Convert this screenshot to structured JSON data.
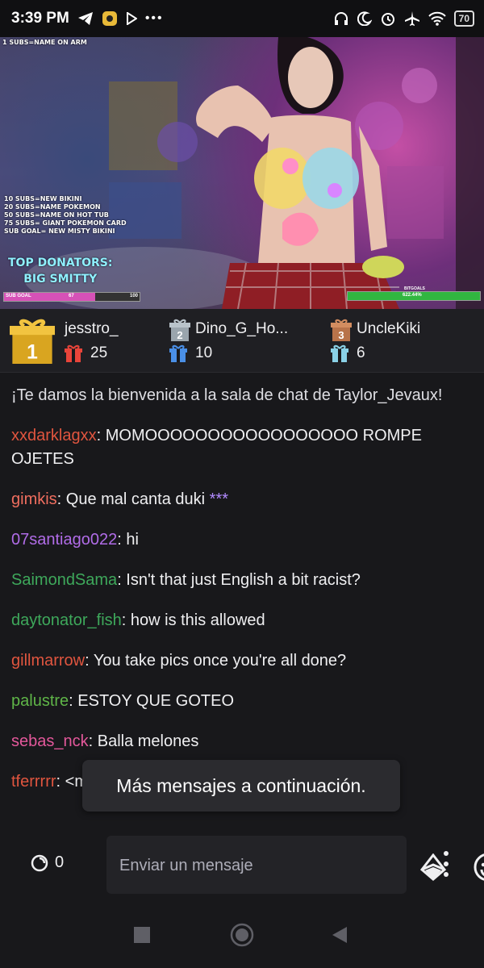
{
  "status_bar": {
    "time": "3:39 PM",
    "battery": "70",
    "left_icons": [
      "telegram-icon",
      "app-badge-icon",
      "play-store-icon",
      "more-dots-icon"
    ],
    "right_icons": [
      "headphones-icon",
      "moon-icon",
      "alarm-icon",
      "airplane-icon",
      "wifi-icon"
    ]
  },
  "stream": {
    "top_overlay": "1 SUBS=NAME ON ARM",
    "sub_goals": "10 SUBS=NEW BIKINI\n20 SUBS=NAME POKEMON\n50 SUBS=NAME ON HOT TUB\n75 SUBS= GIANT POKEMON CARD\nSUB GOAL= NEW MISTY BIKINI",
    "donators_title": "TOP DONATORS:",
    "donators_name": "BIG SMITTY",
    "sub_goal_label": "SUB GOAL",
    "sub_goal_current": "67",
    "sub_goal_target": "100",
    "sub_goal_progress": 0.67,
    "bit_goal_label": "BITGOALS",
    "bit_goal_percent": "622.44%"
  },
  "leaderboard": [
    {
      "rank": "1",
      "name": "jesstro_",
      "count": "25"
    },
    {
      "rank": "2",
      "name": "Dino_G_Ho...",
      "count": "10"
    },
    {
      "rank": "3",
      "name": "UncleKiki",
      "count": "6"
    }
  ],
  "chat": {
    "welcome": "¡Te damos la bienvenida a la sala de chat de Taylor_Jevaux!",
    "messages": [
      {
        "user": "xxdarklagxx",
        "color": "#e0553f",
        "text": ": MOMOOOOOOOOOOOOOOOOO ROMPE OJETES"
      },
      {
        "user": "gimkis",
        "color": "#f06e5f",
        "text": ": Que mal canta duki ",
        "extra": "***",
        "extra_color": "#b28bff"
      },
      {
        "user": "07santiago022",
        "color": "#b16ce8",
        "text": ": hi"
      },
      {
        "user": "SaimondSama",
        "color": "#3ea85b",
        "text": ": Isn't that just English a bit racist?"
      },
      {
        "user": "daytonator_fish",
        "color": "#3ea85b",
        "text": ": how is this allowed"
      },
      {
        "user": "gillmarrow",
        "color": "#e0553f",
        "text": ": You take pics once you're all done?"
      },
      {
        "user": "palustre",
        "color": "#5fb548",
        "text": ": ESTOY QUE GOTEO"
      },
      {
        "user": "sebas_nck",
        "color": "#e4589b",
        "text": ": Balla melones"
      },
      {
        "user": "tferrrrr",
        "color": "#e0553f",
        "text": ": <mensaje eliminado>"
      }
    ]
  },
  "toast": "Más mensajes a continuación.",
  "input": {
    "points": "0",
    "placeholder": "Enviar un mensaje"
  },
  "colors": {
    "background": "#18181b",
    "leaderboard_bg": "#1f1f23",
    "gift_red": "#e8443a",
    "gift_blue": "#4a8fe6",
    "gift_teal": "#8ad1e6"
  }
}
